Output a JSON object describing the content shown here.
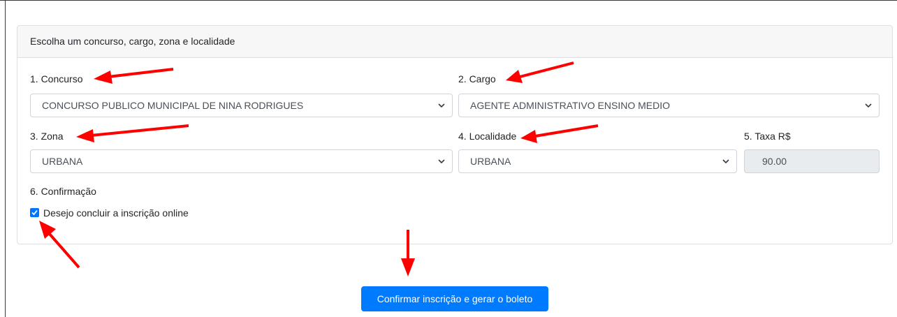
{
  "card": {
    "header": "Escolha um concurso, cargo, zona e localidade"
  },
  "form": {
    "concurso": {
      "label": "1. Concurso",
      "value": "CONCURSO PUBLICO MUNICIPAL DE NINA RODRIGUES"
    },
    "cargo": {
      "label": "2. Cargo",
      "value": "AGENTE ADMINISTRATIVO ENSINO MEDIO"
    },
    "zona": {
      "label": "3. Zona",
      "value": "URBANA"
    },
    "localidade": {
      "label": "4. Localidade",
      "value": "URBANA"
    },
    "taxa": {
      "label": "5. Taxa R$",
      "value": "90.00"
    },
    "confirmacao": {
      "label": "6. Confirmação",
      "checkbox_label": "Desejo concluir a inscrição online",
      "checked": true
    }
  },
  "submit_button": {
    "label": "Confirmar inscrição e gerar o boleto"
  },
  "colors": {
    "primary": "#007bff",
    "checkbox": "#0075ff",
    "annotation_arrow": "#ff0000",
    "readonly_bg": "#e9ecef"
  }
}
